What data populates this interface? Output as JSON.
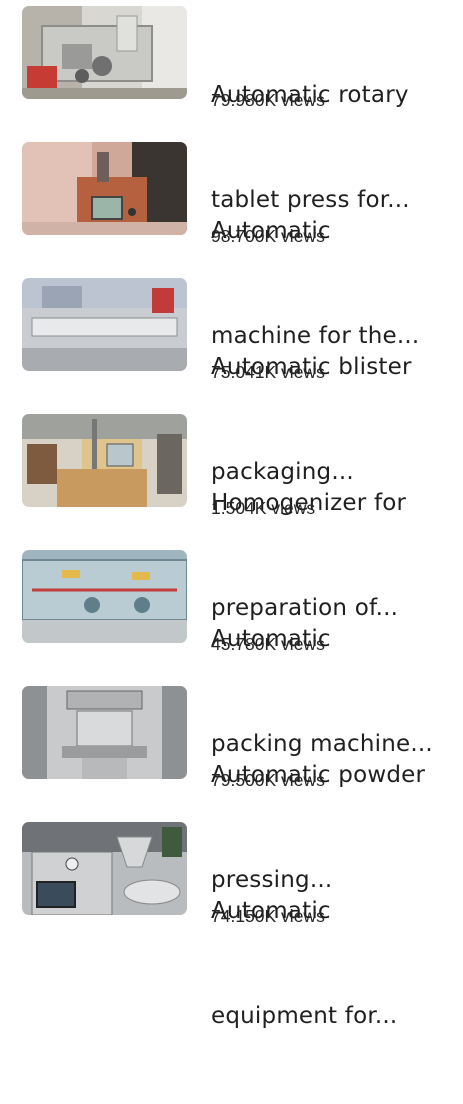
{
  "videos": [
    {
      "title_line1": "Automatic rotary",
      "title_line2": "tablet press for...",
      "views": "79.980K views",
      "thumb_icon": "tablet-press-machine-photo"
    },
    {
      "title_line1": "Automatic",
      "title_line2": "machine for the...",
      "views": "98.700K views",
      "thumb_icon": "control-panel-machine-photo"
    },
    {
      "title_line1": "Automatic blister",
      "title_line2": "packaging...",
      "views": "75.041K views",
      "thumb_icon": "blister-packaging-machine-photo"
    },
    {
      "title_line1": "Homogenizer for",
      "title_line2": "preparation of...",
      "views": "1.504K views",
      "thumb_icon": "homogenizer-machine-photo"
    },
    {
      "title_line1": "Automatic",
      "title_line2": "packing machine...",
      "views": "45.780K views",
      "thumb_icon": "packing-machine-photo"
    },
    {
      "title_line1": "Automatic powder",
      "title_line2": "pressing...",
      "views": "79.500K views",
      "thumb_icon": "powder-press-machine-photo"
    },
    {
      "title_line1": "Automatic",
      "title_line2": "equipment for...",
      "views": "74.150K views",
      "thumb_icon": "filling-equipment-machine-photo"
    }
  ]
}
